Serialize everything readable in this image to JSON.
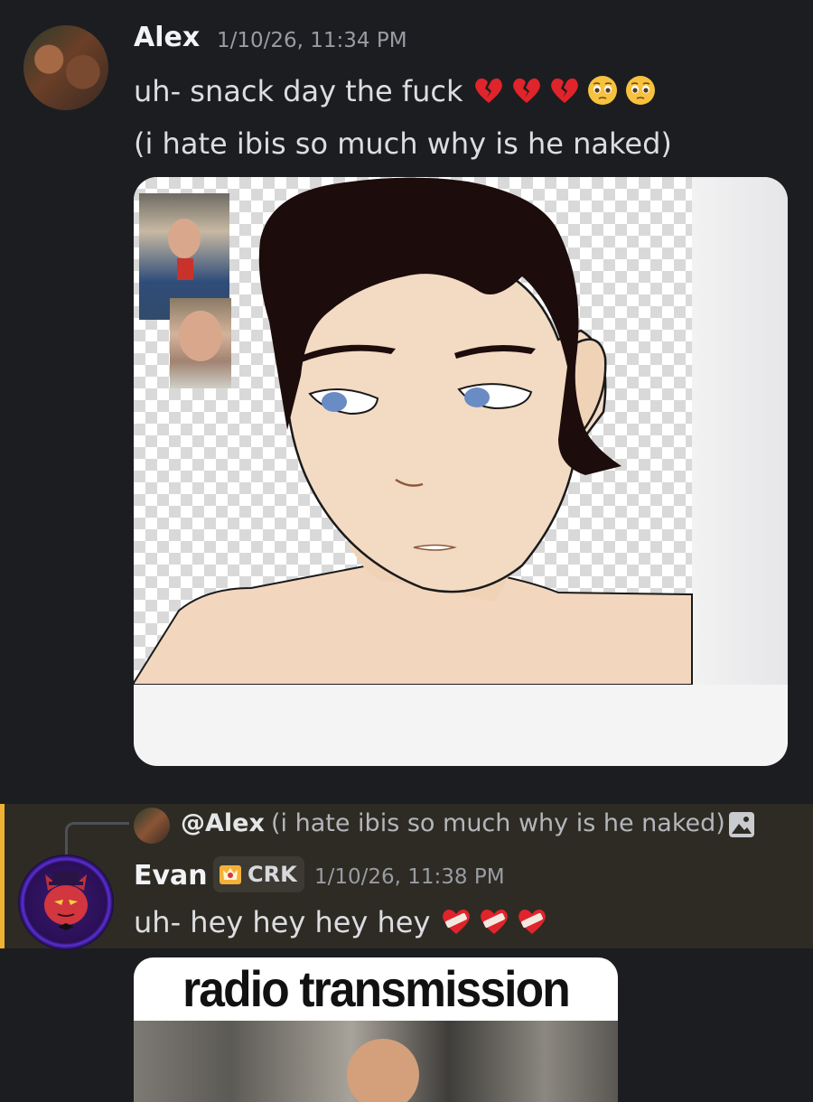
{
  "messages": [
    {
      "author": "Alex",
      "timestamp": "1/10/26, 11:34 PM",
      "line1": "uh- snack day the fuck",
      "line1_emoji": [
        "broken-heart",
        "broken-heart",
        "broken-heart",
        "pleading-face",
        "pleading-face"
      ],
      "line2": "(i hate ibis so much why is he naked)",
      "attachment": "drawing-image"
    },
    {
      "reply": {
        "mention": "@Alex",
        "snippet": "(i hate ibis so much why is he naked)",
        "icon": "image-icon"
      },
      "author": "Evan",
      "tag": "CRK",
      "tag_icon": "crown-shield-icon",
      "timestamp": "1/10/26, 11:38 PM",
      "line1": "uh- hey hey hey hey",
      "line1_emoji": [
        "mending-heart",
        "mending-heart",
        "mending-heart"
      ],
      "attachment_title": "radio transmission"
    }
  ],
  "colors": {
    "background": "#1c1d21",
    "reply_highlight": "#2d2b24",
    "mention_bar": "#f0b232",
    "broken_heart": "#e0242b",
    "pleading_face": "#f7c23d"
  }
}
